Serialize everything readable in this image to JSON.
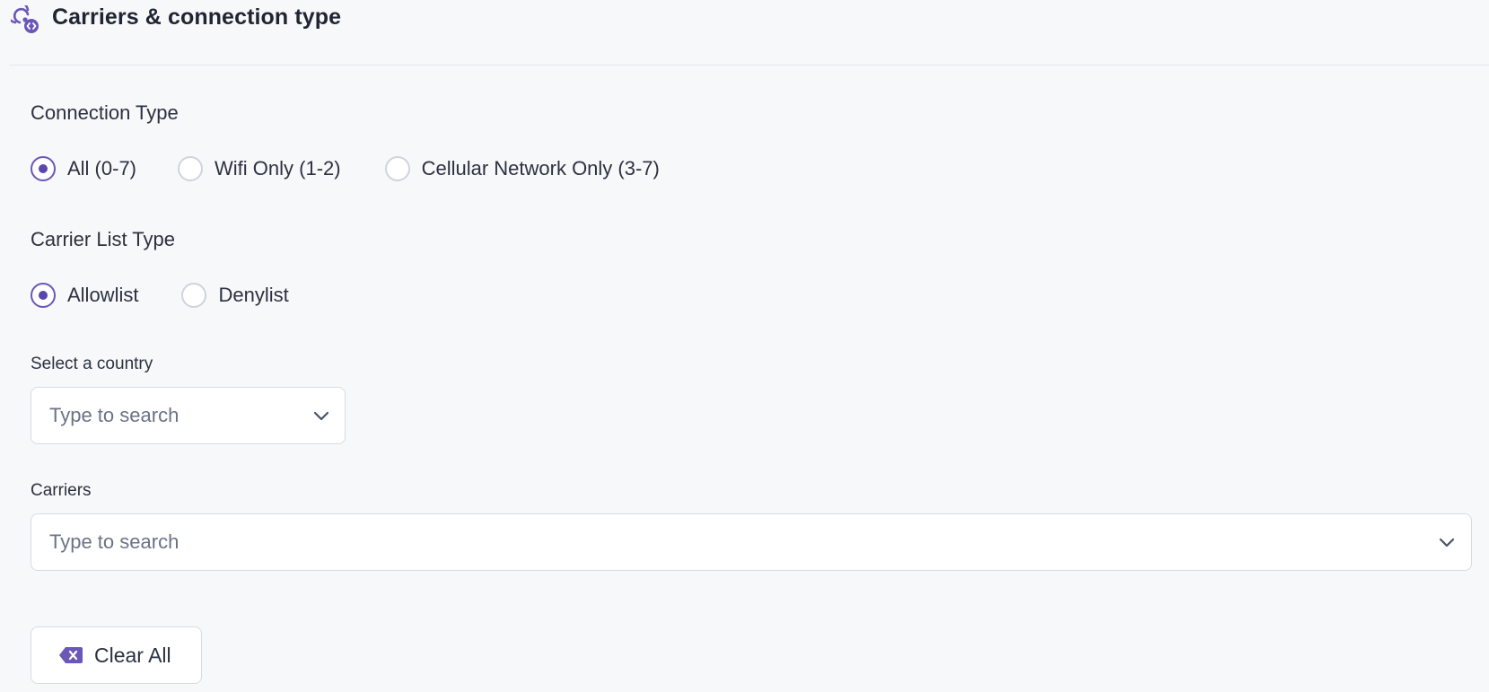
{
  "header": {
    "title": "Carriers & connection type",
    "icon": "carrier-signal-icon",
    "accent_color": "#6b57b8"
  },
  "connection_type": {
    "label": "Connection Type",
    "options": [
      {
        "label": "All (0-7)",
        "selected": true
      },
      {
        "label": "Wifi Only (1-2)",
        "selected": false
      },
      {
        "label": "Cellular Network Only (3-7)",
        "selected": false
      }
    ]
  },
  "carrier_list_type": {
    "label": "Carrier List Type",
    "options": [
      {
        "label": "Allowlist",
        "selected": true
      },
      {
        "label": "Denylist",
        "selected": false
      }
    ]
  },
  "country": {
    "label": "Select a country",
    "placeholder": "Type to search",
    "value": ""
  },
  "carriers": {
    "label": "Carriers",
    "placeholder": "Type to search",
    "value": ""
  },
  "actions": {
    "clear_all_label": "Clear All",
    "clear_icon": "backspace-clear-icon"
  }
}
